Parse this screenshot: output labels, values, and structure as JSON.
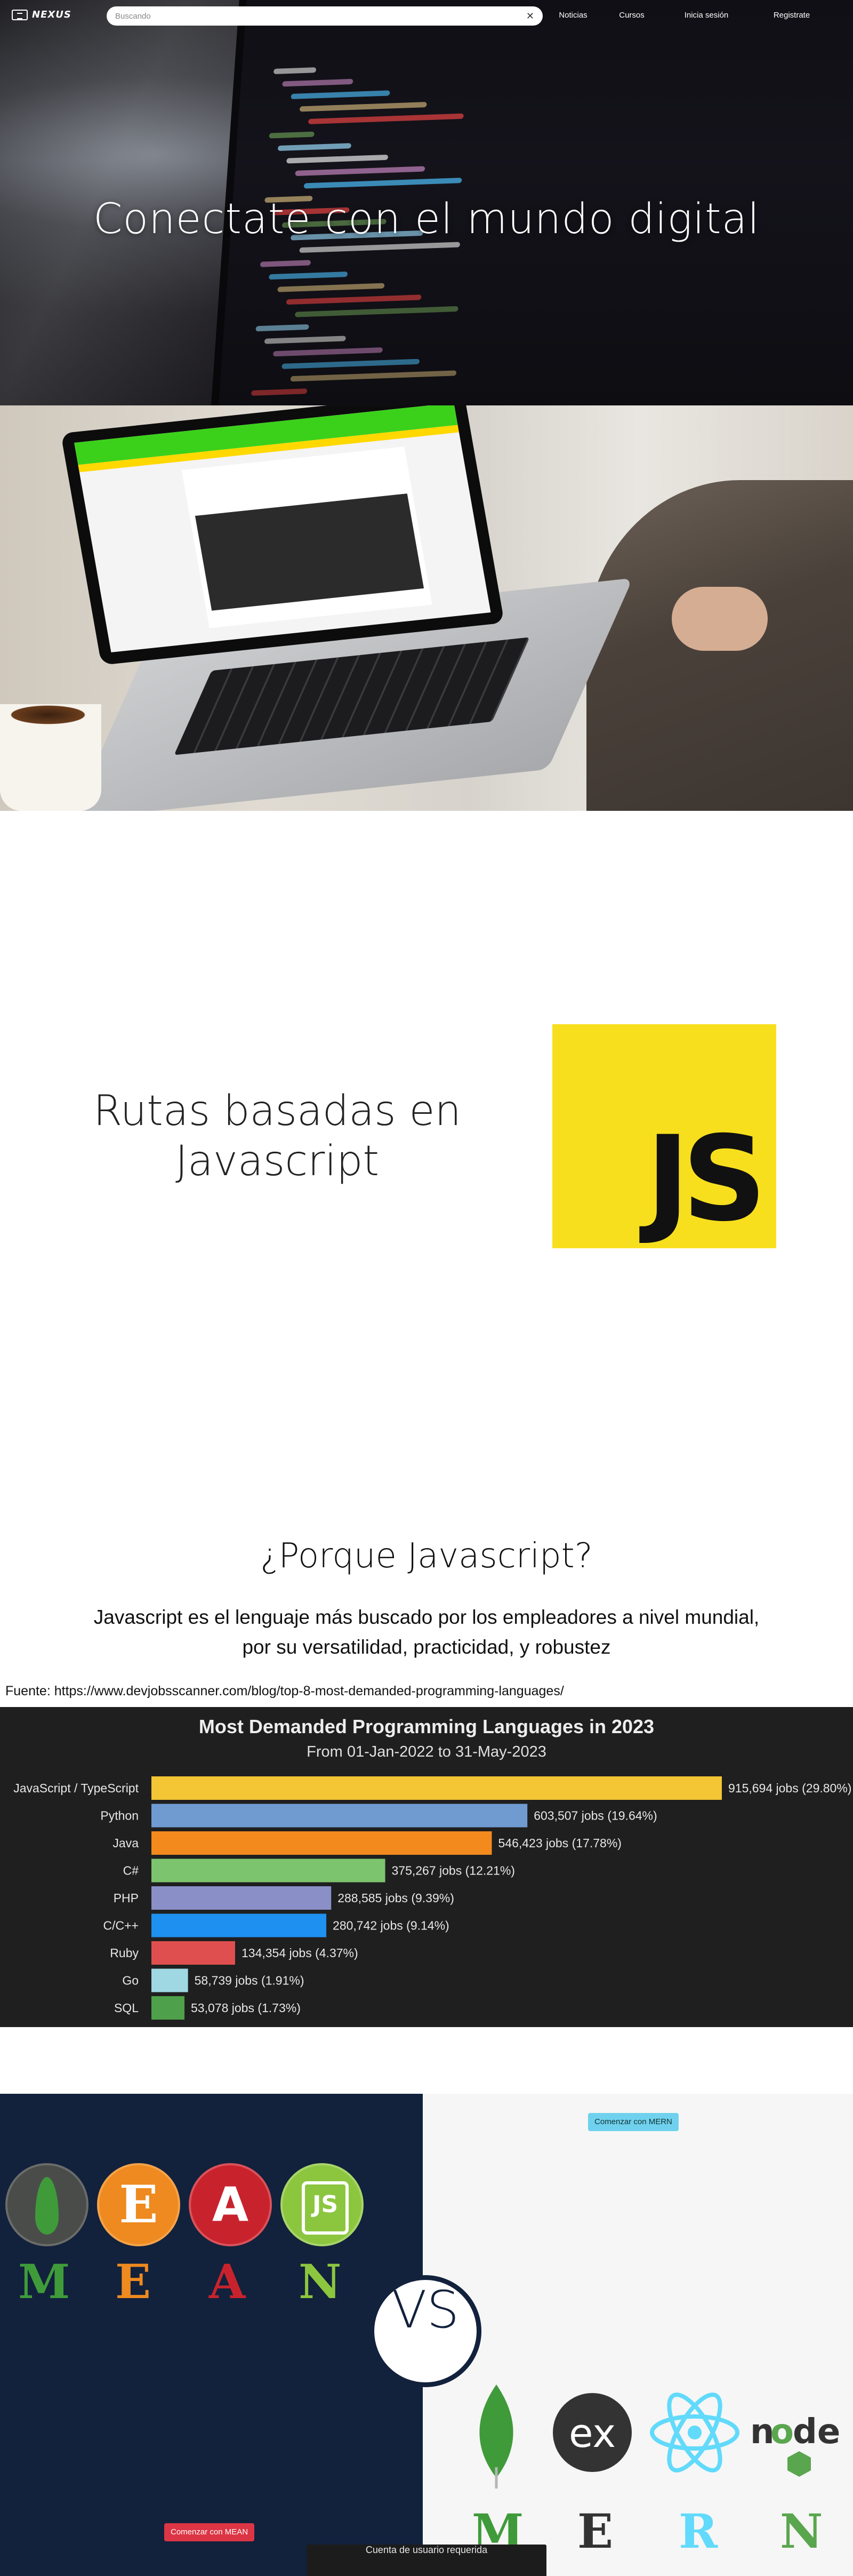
{
  "nav": {
    "brand": "NEXUS",
    "search_placeholder": "Buscando",
    "clear_label": "✕",
    "links": [
      "Noticias",
      "Cursos",
      "Inicia sesión",
      "Registrate"
    ]
  },
  "hero": {
    "title": "Conectate con el mundo digital"
  },
  "rutas": {
    "title_line1": "Rutas basadas en",
    "title_line2": "Javascript",
    "logo_text": "JS"
  },
  "why": {
    "title": "¿Porque Javascript?",
    "text": "Javascript es el lenguaje más buscado por los empleadores a nivel mundial, por su versatilidad, practicidad, y robustez",
    "source": "Fuente: https://www.devjobsscanner.com/blog/top-8-most-demanded-programming-languages/"
  },
  "chart_data": {
    "type": "bar",
    "orientation": "horizontal",
    "title": "Most Demanded Programming Languages in 2023",
    "subtitle": "From 01-Jan-2022 to 31-May-2023",
    "categories": [
      "JavaScript / TypeScript",
      "Python",
      "Java",
      "C#",
      "PHP",
      "C/C++",
      "Ruby",
      "Go",
      "SQL"
    ],
    "values": [
      915694,
      603507,
      546423,
      375267,
      288585,
      280742,
      134354,
      58739,
      53078
    ],
    "labels": [
      "915,694 jobs (29.80%)",
      "603,507 jobs (19.64%)",
      "546,423 jobs (17.78%)",
      "375,267 jobs (12.21%)",
      "288,585 jobs (9.39%)",
      "280,742 jobs (9.14%)",
      "134,354 jobs (4.37%)",
      "58,739 jobs (1.91%)",
      "53,078 jobs (1.73%)"
    ],
    "colors": [
      "#f4c534",
      "#6f9bd1",
      "#f28a1e",
      "#7dc46e",
      "#8a8fc7",
      "#1e90f0",
      "#e04f4f",
      "#9fd8e2",
      "#4fa04a"
    ],
    "xlim": [
      0,
      915694
    ]
  },
  "stack": {
    "mean_letters": [
      "M",
      "E",
      "A",
      "N"
    ],
    "mern_letters": [
      "M",
      "E",
      "R",
      "N"
    ],
    "express_letter": "E",
    "vs": "VS",
    "mean_button": "Comenzar con MEAN",
    "mern_button": "Comenzar con MERN",
    "colors": {
      "mean_bg": "#12213c",
      "mern_bg": "#f6f6f6",
      "mongo": "#3f9b3a",
      "express": "#ee8a1f",
      "angular": "#c8232d",
      "node": "#8cc63f",
      "react": "#61dafb"
    }
  },
  "toast": "Cuenta de usuario requerida"
}
